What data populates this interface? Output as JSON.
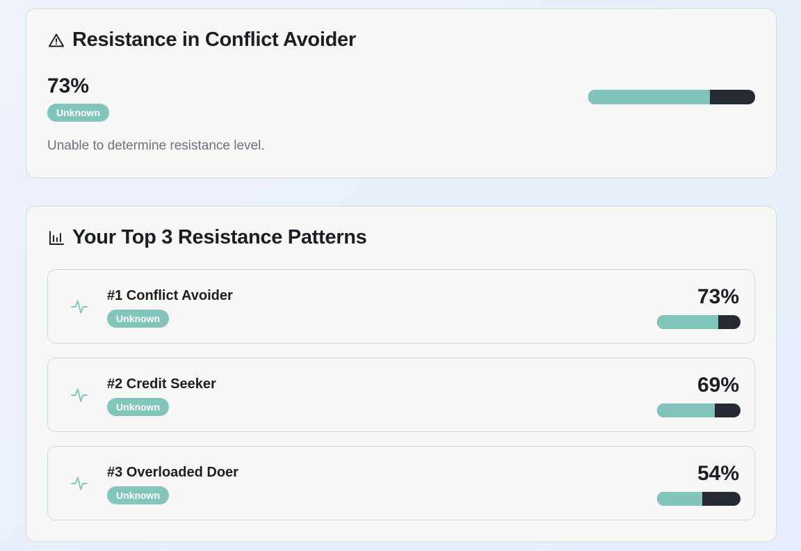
{
  "summary": {
    "title": "Resistance in Conflict Avoider",
    "score_text": "73%",
    "score_fraction": 0.73,
    "badge": "Unknown",
    "description": "Unable to determine resistance level."
  },
  "patterns": {
    "title": "Your Top 3 Resistance Patterns",
    "items": [
      {
        "name": "#1 Conflict Avoider",
        "badge": "Unknown",
        "score_text": "73%",
        "score_fraction": 0.73
      },
      {
        "name": "#2 Credit Seeker",
        "badge": "Unknown",
        "score_text": "69%",
        "score_fraction": 0.69
      },
      {
        "name": "#3 Overloaded Doer",
        "badge": "Unknown",
        "score_text": "54%",
        "score_fraction": 0.54
      }
    ]
  },
  "colors": {
    "accent": "#82c5bc",
    "bar_track": "#262b33",
    "card_border": "#c9e2dc",
    "card_bg": "#f7f7f5"
  },
  "icons": {
    "summary": "alert-triangle-icon",
    "patterns": "bar-chart-icon",
    "pattern_item": "activity-pulse-icon"
  }
}
